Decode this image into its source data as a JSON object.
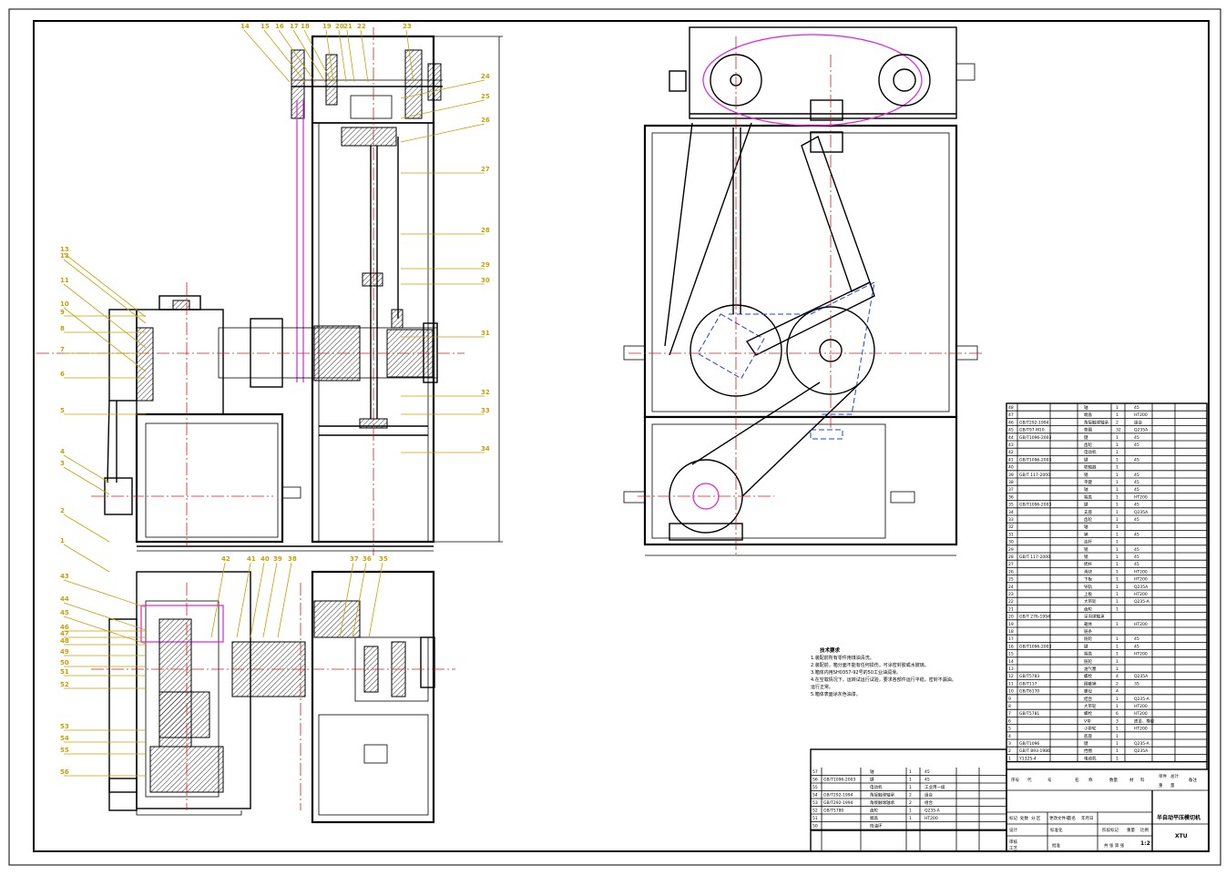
{
  "drawing": {
    "title_block": {
      "name": "半自动平压模切机",
      "org": "XTU",
      "scale": "1:2",
      "headers": [
        "序号",
        "代",
        "号",
        "名",
        "称",
        "数量",
        "材",
        "料",
        "单件",
        "总计",
        "重",
        "量",
        "备注"
      ],
      "row_labels": [
        "标记",
        "处数",
        "分 区",
        "更改文件号",
        "签名",
        "年月日",
        "设计",
        "标准化",
        "阶段标记",
        "重量",
        "比例",
        "审核",
        "工艺",
        "批准",
        "共 张 第 张"
      ],
      "scale_label": "比例"
    },
    "tech_requirements": {
      "heading": "技术要求",
      "lines": [
        "1.装配前所有零件用煤油清洗。",
        "2.装配前，箱分面不能有任何损伤，可涂密封胶或水玻璃。",
        "3.箱体内用SH0357-92号的50工业油润滑。",
        "4.在空载情况下，运转试运行试验，要求各部件运行平稳，密封不漏油。",
        "  运行正常。",
        "5.箱体表面涂灰色油漆。"
      ]
    },
    "balloons_top": [
      "14",
      "15",
      "16",
      "17",
      "18",
      "19",
      "20",
      "21",
      "22",
      "23"
    ],
    "balloons_right": [
      "24",
      "25",
      "26",
      "27",
      "28",
      "29",
      "30",
      "31",
      "32",
      "33",
      "34"
    ],
    "balloons_left": [
      "13",
      "12",
      "11",
      "10",
      "9",
      "8",
      "7",
      "6",
      "5",
      "4",
      "3",
      "2",
      "1"
    ],
    "balloons_plan_top": [
      "42",
      "41",
      "40",
      "39",
      "38",
      "37",
      "36",
      "35"
    ],
    "balloons_plan_left": [
      "43",
      "44",
      "45",
      "46",
      "47",
      "48",
      "49",
      "50",
      "51",
      "52",
      "53",
      "54",
      "55",
      "56"
    ],
    "parts_list": [
      {
        "no": "48",
        "code": "",
        "name": "轴",
        "qty": "1",
        "mat": "45"
      },
      {
        "no": "47",
        "code": "",
        "name": "端盖",
        "qty": "1",
        "mat": "HT200"
      },
      {
        "no": "46",
        "code": "GB/T292-1994",
        "name": "角接触球轴承",
        "qty": "2",
        "mat": "组合"
      },
      {
        "no": "45",
        "code": "GB/T97 M10",
        "name": "垫圈",
        "qty": "32",
        "mat": "Q235A"
      },
      {
        "no": "44",
        "code": "GB/T1096-2003",
        "name": "键",
        "qty": "1",
        "mat": "45"
      },
      {
        "no": "43",
        "code": "",
        "name": "齿轮",
        "qty": "1",
        "mat": "45"
      },
      {
        "no": "42",
        "code": "",
        "name": "电动机",
        "qty": "1",
        "mat": ""
      },
      {
        "no": "41",
        "code": "GB/T1096-2003",
        "name": "键",
        "qty": "1",
        "mat": "45"
      },
      {
        "no": "40",
        "code": "",
        "name": "联轴器",
        "qty": "1",
        "mat": ""
      },
      {
        "no": "39",
        "code": "GB/T 117-2000",
        "name": "销",
        "qty": "1",
        "mat": "45"
      },
      {
        "no": "38",
        "code": "",
        "name": "平键",
        "qty": "1",
        "mat": "45"
      },
      {
        "no": "37",
        "code": "",
        "name": "轴",
        "qty": "1",
        "mat": "45"
      },
      {
        "no": "36",
        "code": "",
        "name": "端盖",
        "qty": "1",
        "mat": "HT200"
      },
      {
        "no": "35",
        "code": "GB/T1096-2003",
        "name": "键",
        "qty": "1",
        "mat": "45"
      },
      {
        "no": "34",
        "code": "",
        "name": "支座",
        "qty": "1",
        "mat": "Q235A"
      },
      {
        "no": "33",
        "code": "",
        "name": "齿轮",
        "qty": "1",
        "mat": "45"
      },
      {
        "no": "32",
        "code": "",
        "name": "轴",
        "qty": "1",
        "mat": ""
      },
      {
        "no": "31",
        "code": "",
        "name": "销",
        "qty": "1",
        "mat": "45"
      },
      {
        "no": "30",
        "code": "",
        "name": "连杆",
        "qty": "1",
        "mat": ""
      },
      {
        "no": "29",
        "code": "",
        "name": "销",
        "qty": "1",
        "mat": "45"
      },
      {
        "no": "28",
        "code": "GB/T 117-2000",
        "name": "销",
        "qty": "1",
        "mat": "45"
      },
      {
        "no": "27",
        "code": "",
        "name": "摇杆",
        "qty": "1",
        "mat": "45"
      },
      {
        "no": "26",
        "code": "",
        "name": "滑块",
        "qty": "1",
        "mat": "HT200"
      },
      {
        "no": "25",
        "code": "",
        "name": "下板",
        "qty": "1",
        "mat": "HT200"
      },
      {
        "no": "24",
        "code": "",
        "name": "导轨",
        "qty": "1",
        "mat": "Q235A"
      },
      {
        "no": "23",
        "code": "",
        "name": "上板",
        "qty": "1",
        "mat": "HT200"
      },
      {
        "no": "22",
        "code": "",
        "name": "大带轮",
        "qty": "1",
        "mat": "Q235-A"
      },
      {
        "no": "21",
        "code": "",
        "name": "齿轮",
        "qty": "1",
        "mat": ""
      },
      {
        "no": "20",
        "code": "GB/T 276-1994",
        "name": "深沟球轴承",
        "qty": "",
        "mat": ""
      },
      {
        "no": "19",
        "code": "",
        "name": "箱体",
        "qty": "1",
        "mat": "HT200"
      },
      {
        "no": "18",
        "code": "",
        "name": "链条",
        "qty": "",
        "mat": ""
      },
      {
        "no": "17",
        "code": "",
        "name": "链轮",
        "qty": "1",
        "mat": "45"
      },
      {
        "no": "16",
        "code": "GB/T1096-2003",
        "name": "键",
        "qty": "1",
        "mat": "45"
      },
      {
        "no": "15",
        "code": "",
        "name": "端盖",
        "qty": "1",
        "mat": "HT200"
      },
      {
        "no": "14",
        "code": "",
        "name": "链轮",
        "qty": "1",
        "mat": ""
      },
      {
        "no": "13",
        "code": "",
        "name": "油气塞",
        "qty": "1",
        "mat": ""
      },
      {
        "no": "12",
        "code": "GB/T5783",
        "name": "螺栓",
        "qty": "4",
        "mat": "Q235A"
      },
      {
        "no": "11",
        "code": "GB/T117",
        "name": "圆锥销",
        "qty": "2",
        "mat": "35"
      },
      {
        "no": "10",
        "code": "GB/T6170",
        "name": "螺母",
        "qty": "4",
        "mat": ""
      },
      {
        "no": "9",
        "code": "",
        "name": "结合",
        "qty": "1",
        "mat": "Q235-A"
      },
      {
        "no": "8",
        "code": "",
        "name": "大带轮",
        "qty": "1",
        "mat": "HT200"
      },
      {
        "no": "7",
        "code": "GB/T5781",
        "name": "螺栓",
        "qty": "6",
        "mat": "HT200"
      },
      {
        "no": "6",
        "code": "",
        "name": "V带",
        "qty": "3",
        "mat": "皮革、橡胶"
      },
      {
        "no": "5",
        "code": "",
        "name": "小带轮",
        "qty": "1",
        "mat": "HT200"
      },
      {
        "no": "4",
        "code": "",
        "name": "底座",
        "qty": "1",
        "mat": ""
      },
      {
        "no": "3",
        "code": "GB/T1096",
        "name": "键",
        "qty": "1",
        "mat": "Q235-A"
      },
      {
        "no": "2",
        "code": "GB/T 893-1986",
        "name": "挡圈",
        "qty": "1",
        "mat": "Q235A"
      },
      {
        "no": "1",
        "code": "Y132S-4",
        "name": "电动机",
        "qty": "1",
        "mat": ""
      }
    ],
    "parts_list_lower": [
      {
        "no": "57",
        "code": "",
        "name": "轴",
        "qty": "1",
        "mat": "45"
      },
      {
        "no": "56",
        "code": "GB/T1096-2003",
        "name": "键",
        "qty": "1",
        "mat": "45"
      },
      {
        "no": "55",
        "code": "",
        "name": "电动机",
        "qty": "1",
        "mat": "工业用一级"
      },
      {
        "no": "54",
        "code": "GB/T292-1994",
        "name": "角接触球轴承",
        "qty": "2",
        "mat": "组合"
      },
      {
        "no": "53",
        "code": "GB/T292-1994",
        "name": "角接触球轴承",
        "qty": "2",
        "mat": "组合"
      },
      {
        "no": "52",
        "code": "GB/T5780",
        "name": "齿轮",
        "qty": "1",
        "mat": "Q235-A"
      },
      {
        "no": "51",
        "code": "",
        "name": "端盖",
        "qty": "1",
        "mat": "HT200"
      },
      {
        "no": "50",
        "code": "",
        "name": "挡油环",
        "qty": "",
        "mat": ""
      }
    ]
  }
}
